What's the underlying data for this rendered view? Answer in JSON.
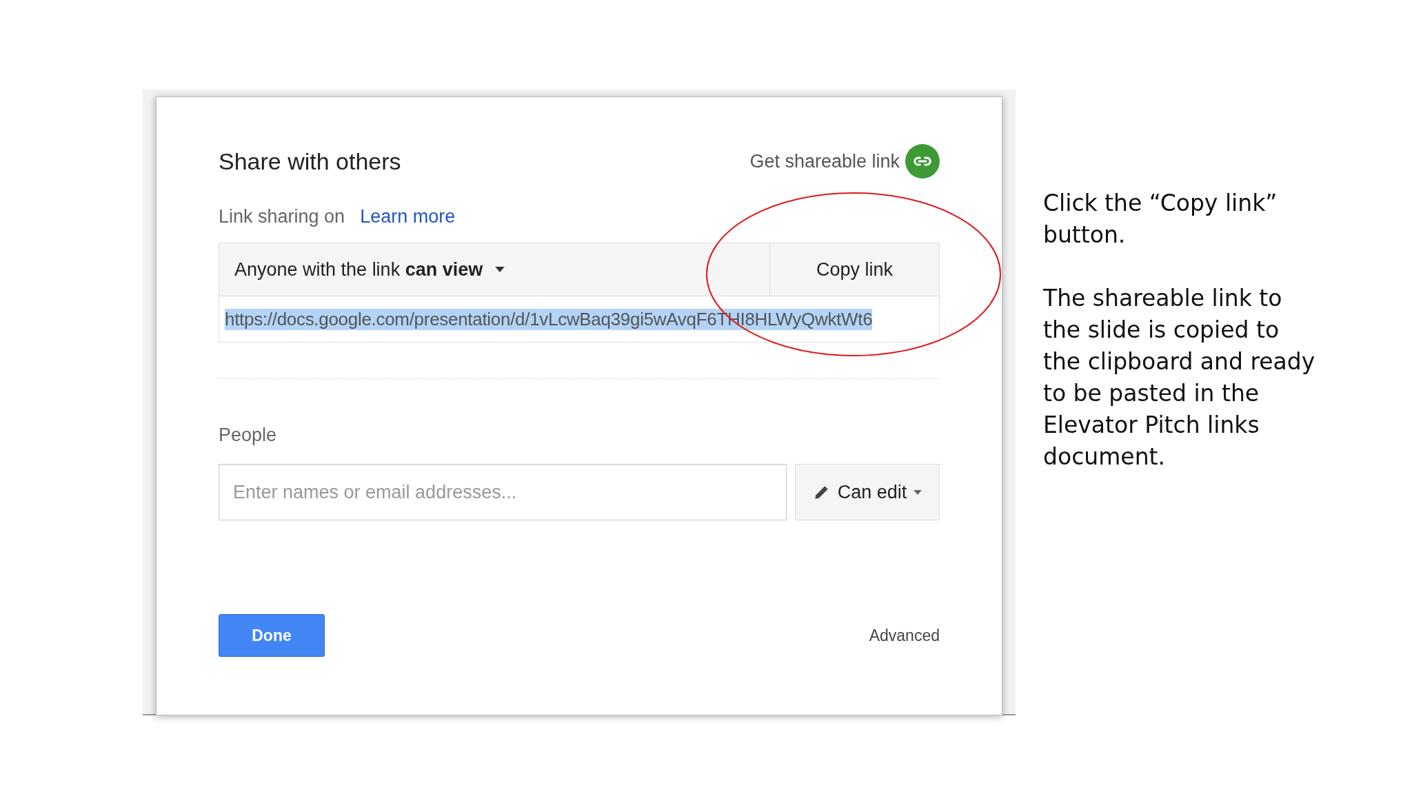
{
  "dialog": {
    "title": "Share with others",
    "shareable_link": {
      "label": "Get shareable link",
      "on": true
    },
    "link_sharing": {
      "status": "Link sharing on",
      "learn_more": "Learn more"
    },
    "access": "Anyone with the link **can view**",
    "copy_button": "Copy link",
    "url": {
      "value": "https://docs.google.com/presentation/d/1vLcwBaq39gi5wAvqF6THI8HLWyQwktWt6",
      "selected": true
    },
    "people": {
      "label": "People",
      "placeholder": "Enter names or email addresses...",
      "permission": "Can edit"
    },
    "done_button": "Done",
    "advanced": "Advanced"
  },
  "notes": [
    "Click the “Copy link” button.",
    "The shareable link to the slide is copied to the clipboard and ready to be pasted in the Elevator Pitch links document."
  ]
}
